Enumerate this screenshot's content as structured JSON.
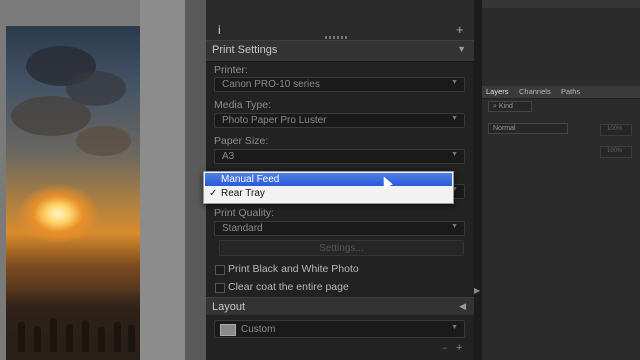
{
  "panel": {
    "info_icon": "i",
    "plus_icon": "+"
  },
  "print_settings": {
    "title": "Print Settings",
    "printer_label": "Printer:",
    "printer_value": "Canon PRO-10 series",
    "media_type_label": "Media Type:",
    "media_type_value": "Photo Paper Pro Luster",
    "paper_size_label": "Paper Size:",
    "paper_size_value": "A3",
    "print_quality_label": "Print Quality:",
    "print_quality_value": "Standard",
    "settings_button": "Settings...",
    "bw_photo_label": "Print Black and White Photo",
    "clear_coat_label": "Clear coat the entire page"
  },
  "paper_source_popup": {
    "options": [
      "Manual Feed",
      "Rear Tray"
    ],
    "highlighted": "Manual Feed",
    "checked": "Rear Tray",
    "check_mark": "✓"
  },
  "layout": {
    "title": "Layout",
    "value": "Custom"
  },
  "layers_panel": {
    "tabs": [
      "Layers",
      "Channels",
      "Paths"
    ],
    "kind_label": "Kind",
    "blend_mode": "Normal",
    "opacity": "100%",
    "fill": "100%"
  },
  "icons": {
    "collapse": "▼",
    "expand": "◀",
    "caret": "▼",
    "scroll": "▶"
  },
  "colors": {
    "panel_bg": "#222222",
    "highlight": "#2a5ad9",
    "preview_bg": "#7a7a7a"
  }
}
